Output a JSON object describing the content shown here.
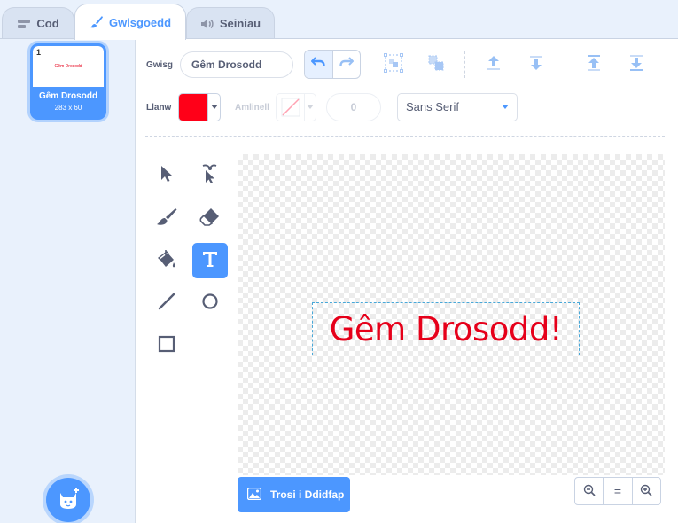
{
  "tabs": [
    {
      "label": "Cod",
      "icon": "code-icon"
    },
    {
      "label": "Gwisgoedd",
      "icon": "brush-icon",
      "active": true
    },
    {
      "label": "Seiniau",
      "icon": "speaker-icon"
    }
  ],
  "costume_list": {
    "items": [
      {
        "number": "1",
        "name": "Gêm Drosodd",
        "size": "283 x 60",
        "preview_text": "Gêm Drosodd"
      }
    ],
    "add_button_icon": "cat-add-icon"
  },
  "toolbar": {
    "costume_label": "Gwisg",
    "costume_name": "Gêm Drosodd",
    "fill_label": "Llanw",
    "fill_color": "#ff0018",
    "outline_label": "Amlinell",
    "outline_width": "0",
    "font": "Sans Serif"
  },
  "canvas": {
    "text": "Gêm Drosodd!",
    "text_color": "#e6001a"
  },
  "footer": {
    "convert_label": "Trosi i Ddidfap",
    "zoom_reset_label": "="
  },
  "colors": {
    "accent": "#4c97ff",
    "background": "#e9f1fc"
  }
}
